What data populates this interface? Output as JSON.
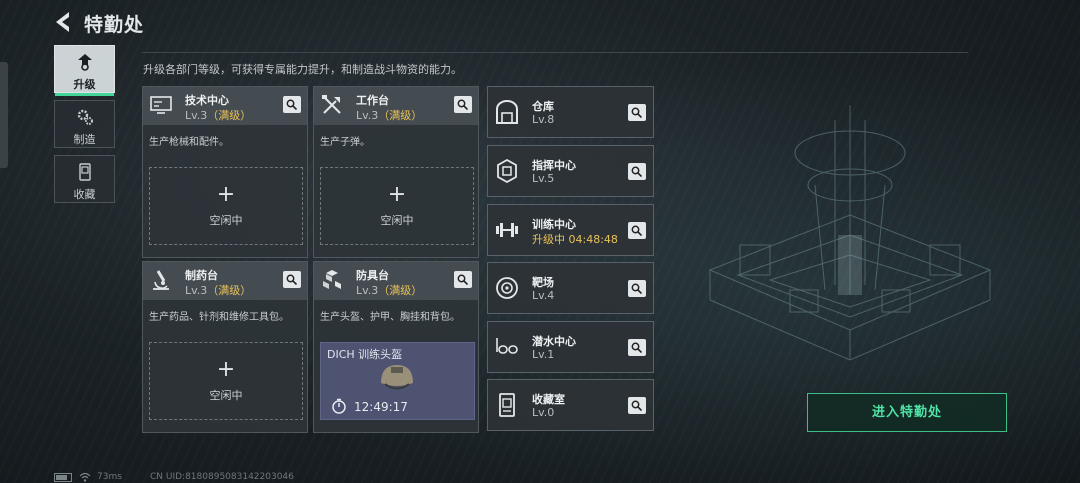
{
  "header": {
    "title": "特勤处"
  },
  "side_nav": [
    {
      "label": "升级",
      "icon": "upgrade-icon",
      "active": true
    },
    {
      "label": "制造",
      "icon": "gears-icon",
      "active": false
    },
    {
      "label": "收藏",
      "icon": "collection-icon",
      "active": false
    }
  ],
  "intro": "升级各部门等级，可获得专属能力提升，和制造战斗物资的能力。",
  "cards": [
    {
      "name": "技术中心",
      "level": "Lv.3",
      "max": "（满级）",
      "desc": "生产枪械和配件。",
      "icon": "computer-icon",
      "slot_plus": "+",
      "slot_idle": "空闲中"
    },
    {
      "name": "工作台",
      "level": "Lv.3",
      "max": "（满级）",
      "desc": "生产子弹。",
      "icon": "tools-icon",
      "slot_plus": "+",
      "slot_idle": "空闲中"
    },
    {
      "name": "制药台",
      "level": "Lv.3",
      "max": "（满级）",
      "desc": "生产药品、针剂和维修工具包。",
      "icon": "microscope-icon",
      "slot_plus": "+",
      "slot_idle": "空闲中"
    },
    {
      "name": "防具台",
      "level": "Lv.3",
      "max": "（满级）",
      "desc": "生产头盔、护甲、胸挂和背包。",
      "icon": "boxes-icon",
      "craft_item": "DICH 训练头盔",
      "craft_timer": "12:49:17"
    }
  ],
  "rows": [
    {
      "name": "仓库",
      "level": "Lv.8",
      "icon": "warehouse-icon",
      "upgrading": false
    },
    {
      "name": "指挥中心",
      "level": "Lv.5",
      "icon": "chip-icon",
      "upgrading": false
    },
    {
      "name": "训练中心",
      "level": "升级中 04:48:48",
      "icon": "dumbbell-icon",
      "upgrading": true
    },
    {
      "name": "靶场",
      "level": "Lv.4",
      "icon": "target-icon",
      "upgrading": false
    },
    {
      "name": "潜水中心",
      "level": "Lv.1",
      "icon": "goggles-icon",
      "upgrading": false
    },
    {
      "name": "收藏室",
      "level": "Lv.0",
      "icon": "display-case-icon",
      "upgrading": false
    }
  ],
  "enter_button": "进入特勤处",
  "status": {
    "ping": "73ms",
    "uid": "CN UID:8180895083142203046"
  },
  "colors": {
    "accent": "#44d59a",
    "max_level": "#e8c15a",
    "craft_bg": "#4d5370"
  }
}
